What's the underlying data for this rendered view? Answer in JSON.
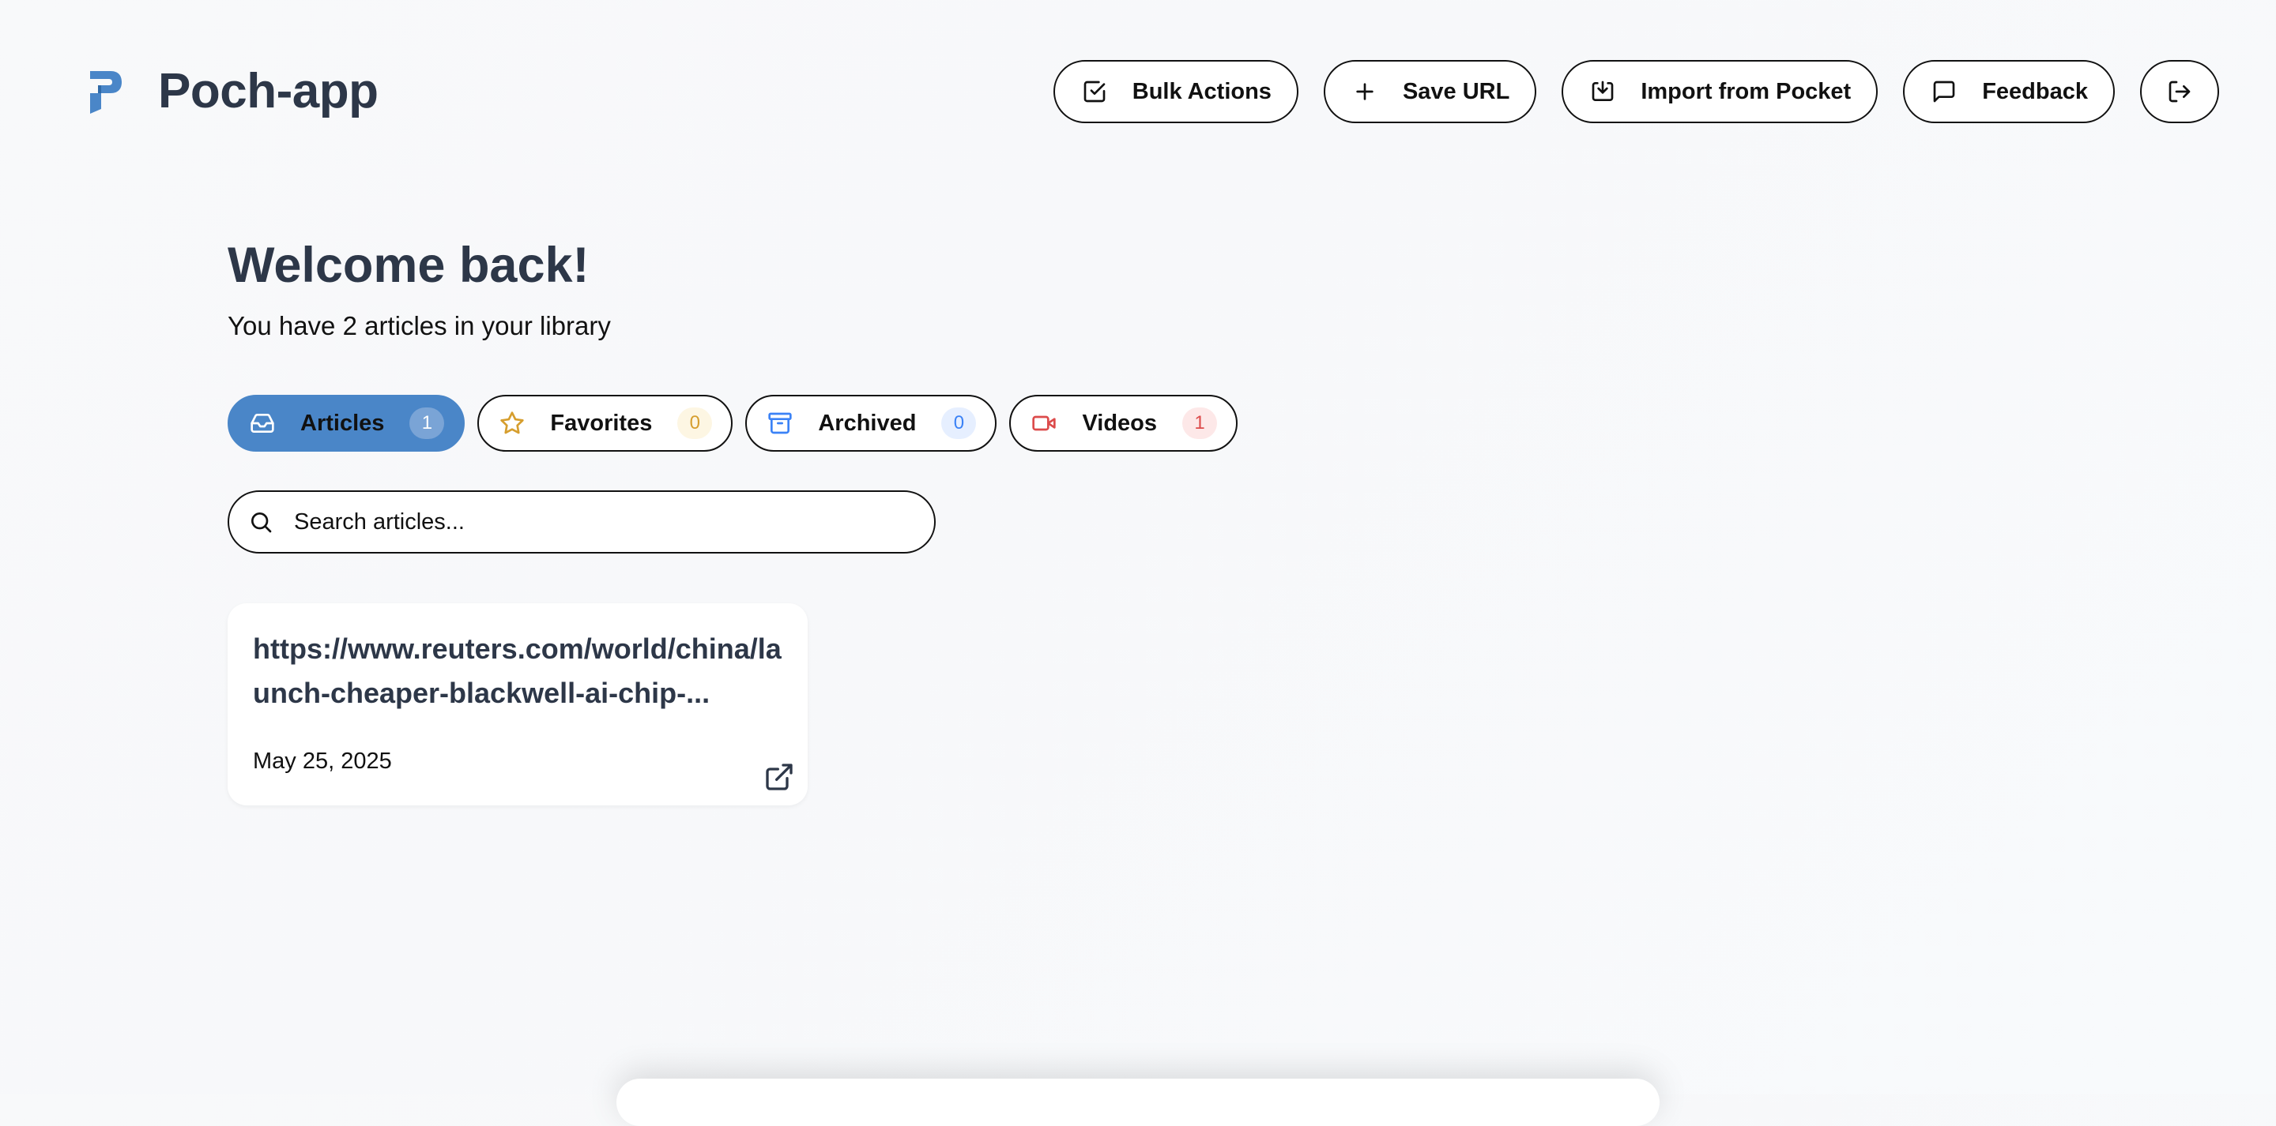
{
  "header": {
    "app_title": "Poch-app",
    "actions": {
      "bulk_actions": "Bulk Actions",
      "save_url": "Save URL",
      "import_pocket": "Import from Pocket",
      "feedback": "Feedback"
    }
  },
  "main": {
    "welcome": "Welcome back!",
    "subtitle": "You have 2 articles in your library"
  },
  "tabs": [
    {
      "label": "Articles",
      "count": "1",
      "active": true
    },
    {
      "label": "Favorites",
      "count": "0",
      "active": false
    },
    {
      "label": "Archived",
      "count": "0",
      "active": false
    },
    {
      "label": "Videos",
      "count": "1",
      "active": false
    }
  ],
  "search": {
    "placeholder": "Search articles..."
  },
  "articles": [
    {
      "title": "https://www.reuters.com/world/china/launch-cheaper-blackwell-ai-chip-...",
      "date": "May 25, 2025"
    }
  ],
  "colors": {
    "brand": "#4a86c8",
    "heading": "#2d3748",
    "favorites_accent": "#d69e2e",
    "archived_accent": "#3b82f6",
    "videos_accent": "#dc4b4b"
  },
  "icons": {
    "logo": "poch-logo-icon",
    "bulk_actions": "checkbox-icon",
    "save_url": "plus-icon",
    "import_pocket": "download-icon",
    "feedback": "message-icon",
    "logout": "logout-icon",
    "articles": "inbox-icon",
    "favorites": "star-icon",
    "archived": "archive-icon",
    "videos": "video-icon",
    "search": "search-icon",
    "open_article": "external-link-icon"
  }
}
